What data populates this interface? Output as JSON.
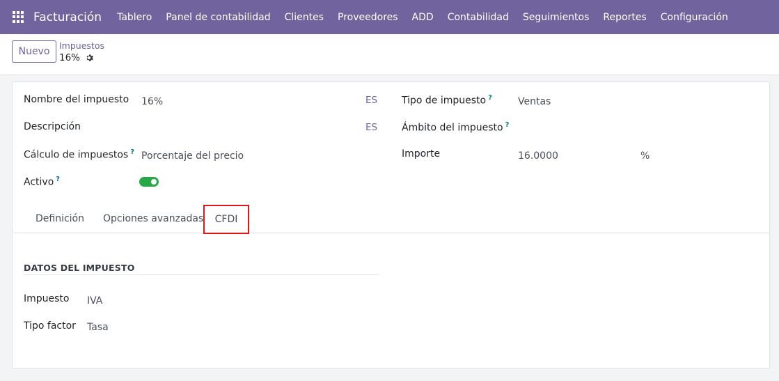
{
  "navbar": {
    "brand": "Facturación",
    "items": [
      "Tablero",
      "Panel de contabilidad",
      "Clientes",
      "Proveedores",
      "ADD",
      "Contabilidad",
      "Seguimientos",
      "Reportes",
      "Configuración"
    ]
  },
  "control": {
    "new_label": "Nuevo",
    "breadcrumb": "Impuestos",
    "record": "16%"
  },
  "form": {
    "name_label": "Nombre del impuesto",
    "name_value": "16%",
    "lang": "ES",
    "description_label": "Descripción",
    "computation_label": "Cálculo de impuestos",
    "computation_value": "Porcentaje del precio",
    "active_label": "Activo",
    "active_value": true,
    "type_label": "Tipo de impuesto",
    "type_value": "Ventas",
    "scope_label": "Ámbito del impuesto",
    "amount_label": "Importe",
    "amount_value": "16.0000",
    "amount_unit": "%",
    "help_mark": "?"
  },
  "tabs": [
    "Definición",
    "Opciones avanzadas",
    "CFDI"
  ],
  "active_tab": "CFDI",
  "cfdi": {
    "section_title": "DATOS DEL IMPUESTO",
    "tax_label": "Impuesto",
    "tax_value": "IVA",
    "factor_label": "Tipo factor",
    "factor_value": "Tasa"
  },
  "colors": {
    "brand": "#71639e",
    "toggle_on": "#28a745",
    "highlight": "#e0161b",
    "help": "#017e84"
  }
}
